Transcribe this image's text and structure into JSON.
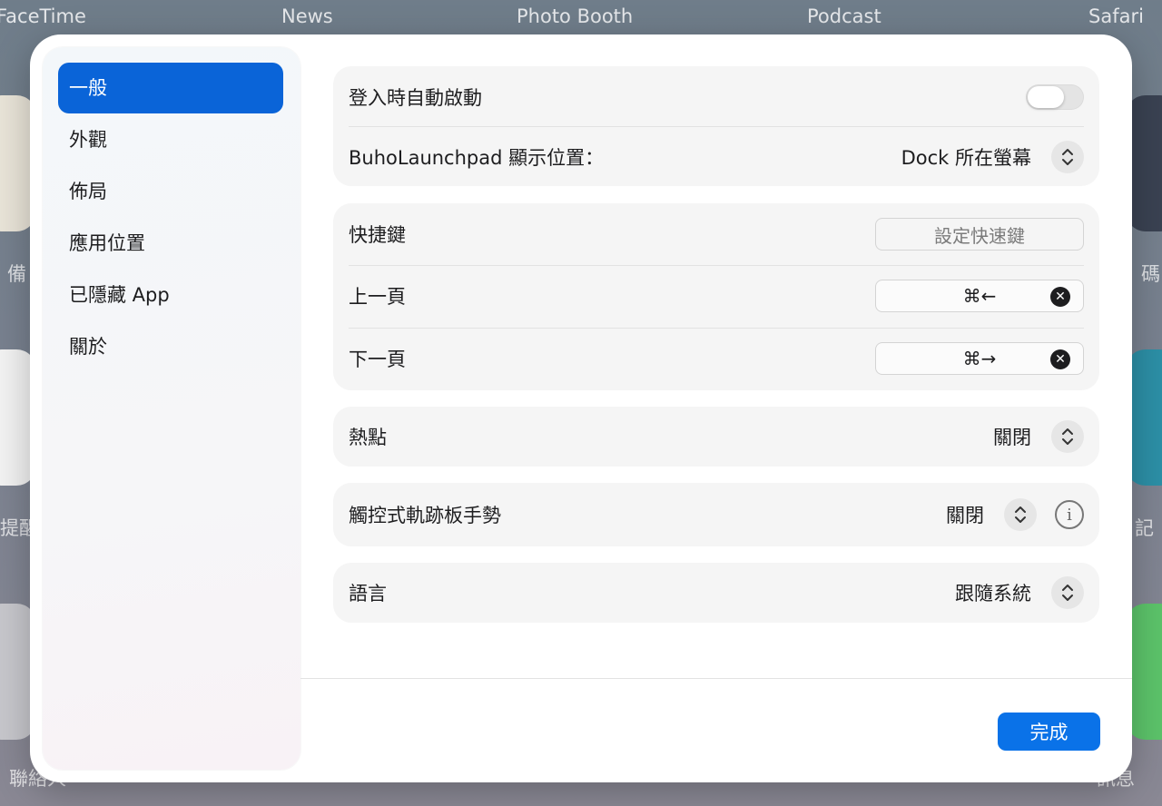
{
  "background": {
    "top_labels": [
      "FaceTime",
      "News",
      "Photo Booth",
      "Podcast",
      "Safari"
    ],
    "side_labels": [
      "備",
      "提醒",
      "聯絡人",
      "碼",
      "記",
      "訊息"
    ]
  },
  "sidebar": {
    "items": [
      {
        "label": "一般",
        "active": true
      },
      {
        "label": "外觀"
      },
      {
        "label": "佈局"
      },
      {
        "label": "應用位置"
      },
      {
        "label": "已隱藏 App"
      },
      {
        "label": "關於"
      }
    ]
  },
  "settings": {
    "launch_at_login": {
      "label": "登入時自動啟動",
      "on": false
    },
    "display_position": {
      "label": "BuhoLaunchpad 顯示位置：",
      "value": "Dock 所在螢幕"
    },
    "hotkey": {
      "label": "快捷鍵",
      "placeholder": "設定快速鍵"
    },
    "prev_page": {
      "label": "上一頁",
      "shortcut": "⌘←"
    },
    "next_page": {
      "label": "下一頁",
      "shortcut": "⌘→"
    },
    "hot_corner": {
      "label": "熱點",
      "value": "關閉"
    },
    "trackpad_gesture": {
      "label": "觸控式軌跡板手勢",
      "value": "關閉"
    },
    "language": {
      "label": "語言",
      "value": "跟隨系統"
    }
  },
  "footer": {
    "done_label": "完成"
  },
  "colors": {
    "accent": "#0a64d8",
    "button": "#0a72e8"
  }
}
